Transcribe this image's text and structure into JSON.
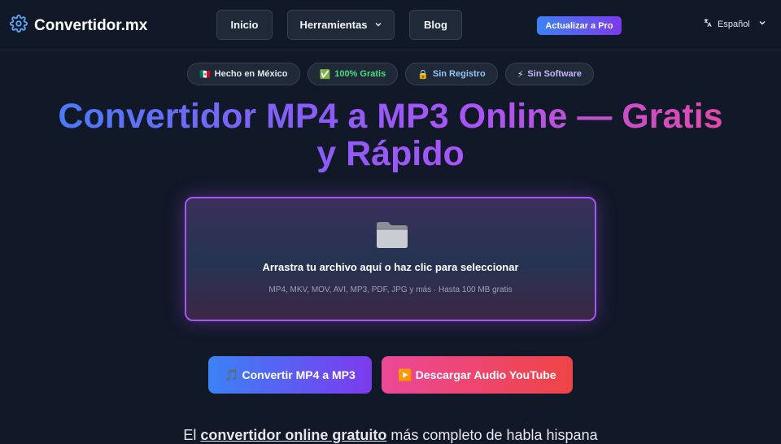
{
  "header": {
    "brand": "Convertidor.mx",
    "nav": {
      "home": "Inicio",
      "tools": "Herramientas",
      "blog": "Blog"
    },
    "pro_button": "Actualizar a Pro",
    "language": "Español"
  },
  "badges": [
    {
      "emoji": "🇲🇽",
      "label": "Hecho en México",
      "color": "#e5e7eb"
    },
    {
      "emoji": "✅",
      "label": "100% Gratis",
      "color": "#4ade80"
    },
    {
      "emoji": "🔒",
      "label": "Sin Registro",
      "color": "#93c5fd"
    },
    {
      "emoji": "⚡",
      "label": "Sin Software",
      "color": "#c4b5fd"
    }
  ],
  "hero": {
    "title_line1": "Convertidor MP4 a MP3 Online — Gratis",
    "title_line2": "y Rápido"
  },
  "dropzone": {
    "icon": "folder-icon",
    "title": "Arrastra tu archivo aquí o haz clic para seleccionar",
    "subtitle": "MP4, MKV, MOV, AVI, MP3, PDF, JPG y más · Hasta 100 MB gratis"
  },
  "cta": {
    "convert": "🎵 Convertir MP4 a MP3",
    "youtube": "▶️ Descargar Audio YouTube"
  },
  "intro": {
    "before": "El ",
    "bold": "convertidor online gratuito",
    "after": " más completo de habla hispana"
  },
  "colors": {
    "background": "#111827",
    "accent_blue": "#3b82f6",
    "accent_purple": "#a855f7",
    "accent_pink": "#ec4899"
  }
}
